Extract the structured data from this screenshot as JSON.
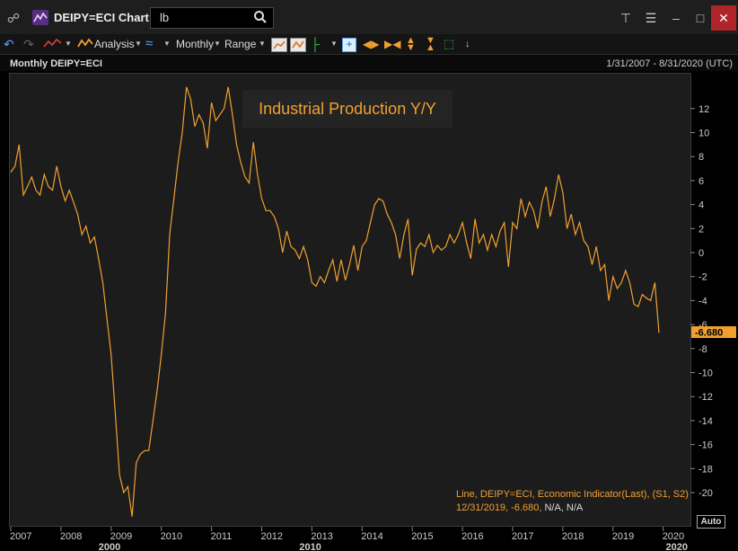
{
  "window": {
    "title": "DEIPY=ECI Chart",
    "search_value": "lb"
  },
  "toolbar": {
    "analysis_label": "Analysis",
    "interval_label": "Monthly",
    "range_label": "Range"
  },
  "chart_header": {
    "title": "Monthly DEIPY=ECI",
    "date_range": "1/31/2007 - 8/31/2020 (UTC)"
  },
  "overlay_title": "Industrial Production Y/Y",
  "legend": {
    "line1": "Line, DEIPY=ECI, Economic Indicator(Last), (S1, S2)",
    "line2_value": "12/31/2019, -6.680,",
    "line2_na": "N/A, N/A"
  },
  "auto_label": "Auto",
  "colors": {
    "series": "#f0a030",
    "background": "#1c1c1c",
    "close": "#b0252a"
  },
  "chart_data": {
    "type": "line",
    "series": [
      {
        "name": "DEIPY=ECI",
        "x": [
          "2007-01",
          "2007-02",
          "2007-03",
          "2007-04",
          "2007-05",
          "2007-06",
          "2007-07",
          "2007-08",
          "2007-09",
          "2007-10",
          "2007-11",
          "2007-12",
          "2008-01",
          "2008-02",
          "2008-03",
          "2008-04",
          "2008-05",
          "2008-06",
          "2008-07",
          "2008-08",
          "2008-09",
          "2008-10",
          "2008-11",
          "2008-12",
          "2009-01",
          "2009-02",
          "2009-03",
          "2009-04",
          "2009-05",
          "2009-06",
          "2009-07",
          "2009-08",
          "2009-09",
          "2009-10",
          "2009-11",
          "2009-12",
          "2010-01",
          "2010-02",
          "2010-03",
          "2010-04",
          "2010-05",
          "2010-06",
          "2010-07",
          "2010-08",
          "2010-09",
          "2010-10",
          "2010-11",
          "2010-12",
          "2011-01",
          "2011-02",
          "2011-03",
          "2011-04",
          "2011-05",
          "2011-06",
          "2011-07",
          "2011-08",
          "2011-09",
          "2011-10",
          "2011-11",
          "2011-12",
          "2012-01",
          "2012-02",
          "2012-03",
          "2012-04",
          "2012-05",
          "2012-06",
          "2012-07",
          "2012-08",
          "2012-09",
          "2012-10",
          "2012-11",
          "2012-12",
          "2013-01",
          "2013-02",
          "2013-03",
          "2013-04",
          "2013-05",
          "2013-06",
          "2013-07",
          "2013-08",
          "2013-09",
          "2013-10",
          "2013-11",
          "2013-12",
          "2014-01",
          "2014-02",
          "2014-03",
          "2014-04",
          "2014-05",
          "2014-06",
          "2014-07",
          "2014-08",
          "2014-09",
          "2014-10",
          "2014-11",
          "2014-12",
          "2015-01",
          "2015-02",
          "2015-03",
          "2015-04",
          "2015-05",
          "2015-06",
          "2015-07",
          "2015-08",
          "2015-09",
          "2015-10",
          "2015-11",
          "2015-12",
          "2016-01",
          "2016-02",
          "2016-03",
          "2016-04",
          "2016-05",
          "2016-06",
          "2016-07",
          "2016-08",
          "2016-09",
          "2016-10",
          "2016-11",
          "2016-12",
          "2017-01",
          "2017-02",
          "2017-03",
          "2017-04",
          "2017-05",
          "2017-06",
          "2017-07",
          "2017-08",
          "2017-09",
          "2017-10",
          "2017-11",
          "2017-12",
          "2018-01",
          "2018-02",
          "2018-03",
          "2018-04",
          "2018-05",
          "2018-06",
          "2018-07",
          "2018-08",
          "2018-09",
          "2018-10",
          "2018-11",
          "2018-12",
          "2019-01",
          "2019-02",
          "2019-03",
          "2019-04",
          "2019-05",
          "2019-06",
          "2019-07",
          "2019-08",
          "2019-09",
          "2019-10",
          "2019-11",
          "2019-12"
        ],
        "values": [
          6.7,
          7.2,
          9.0,
          4.8,
          5.5,
          6.3,
          5.2,
          4.8,
          6.5,
          5.5,
          5.2,
          7.2,
          5.5,
          4.3,
          5.2,
          4.2,
          3.2,
          1.5,
          2.2,
          0.8,
          1.3,
          -0.5,
          -2.5,
          -5.5,
          -8.5,
          -13.5,
          -18.5,
          -20.0,
          -19.5,
          -22.0,
          -17.5,
          -16.8,
          -16.5,
          -16.5,
          -14.0,
          -11.5,
          -8.5,
          -5.0,
          1.5,
          4.5,
          7.5,
          10.0,
          13.8,
          12.8,
          10.5,
          11.5,
          10.8,
          8.7,
          12.5,
          11.0,
          11.5,
          12.0,
          13.8,
          11.5,
          9.0,
          7.5,
          6.3,
          5.8,
          9.2,
          6.5,
          4.5,
          3.5,
          3.5,
          3.0,
          2.0,
          0.0,
          1.8,
          0.5,
          0.2,
          -0.5,
          0.5,
          -0.6,
          -2.5,
          -2.8,
          -2.0,
          -2.5,
          -1.5,
          -0.6,
          -2.4,
          -0.6,
          -2.3,
          -1.0,
          0.6,
          -1.5,
          0.5,
          1.0,
          2.5,
          4.0,
          4.5,
          4.3,
          3.2,
          2.5,
          1.5,
          -0.5,
          1.5,
          2.8,
          -1.9,
          0.3,
          0.8,
          0.5,
          1.5,
          0.0,
          0.6,
          0.2,
          0.5,
          1.5,
          0.8,
          1.5,
          2.5,
          0.8,
          -0.5,
          2.8,
          0.8,
          1.5,
          0.2,
          1.5,
          0.5,
          1.8,
          2.5,
          -1.2,
          2.5,
          2.0,
          4.5,
          3.0,
          4.2,
          3.5,
          2.0,
          4.2,
          5.5,
          3.0,
          4.5,
          6.5,
          5.0,
          2.0,
          3.2,
          1.5,
          2.5,
          1.0,
          0.5,
          -1.0,
          0.5,
          -1.5,
          -1.0,
          -4.0,
          -2.0,
          -3.0,
          -2.5,
          -1.5,
          -2.5,
          -4.3,
          -4.5,
          -3.5,
          -3.8,
          -4.0,
          -2.5,
          -6.68
        ]
      }
    ],
    "last_value": "-6.680",
    "ylim": [
      -22,
      14
    ],
    "y_ticks": [
      12,
      10,
      8,
      6,
      4,
      2,
      0,
      -2,
      -4,
      -6,
      -8,
      -10,
      -12,
      -14,
      -16,
      -18,
      -20
    ],
    "x_ticks": [
      "2007",
      "2008",
      "2009",
      "2010",
      "2011",
      "2012",
      "2013",
      "2014",
      "2015",
      "2016",
      "2017",
      "2018",
      "2019",
      "2020"
    ],
    "x_group_ticks": [
      {
        "label": "2000",
        "year": 2009
      },
      {
        "label": "2010",
        "year": 2013
      },
      {
        "label": "2020",
        "year": 2020.3
      }
    ],
    "grid": false
  }
}
